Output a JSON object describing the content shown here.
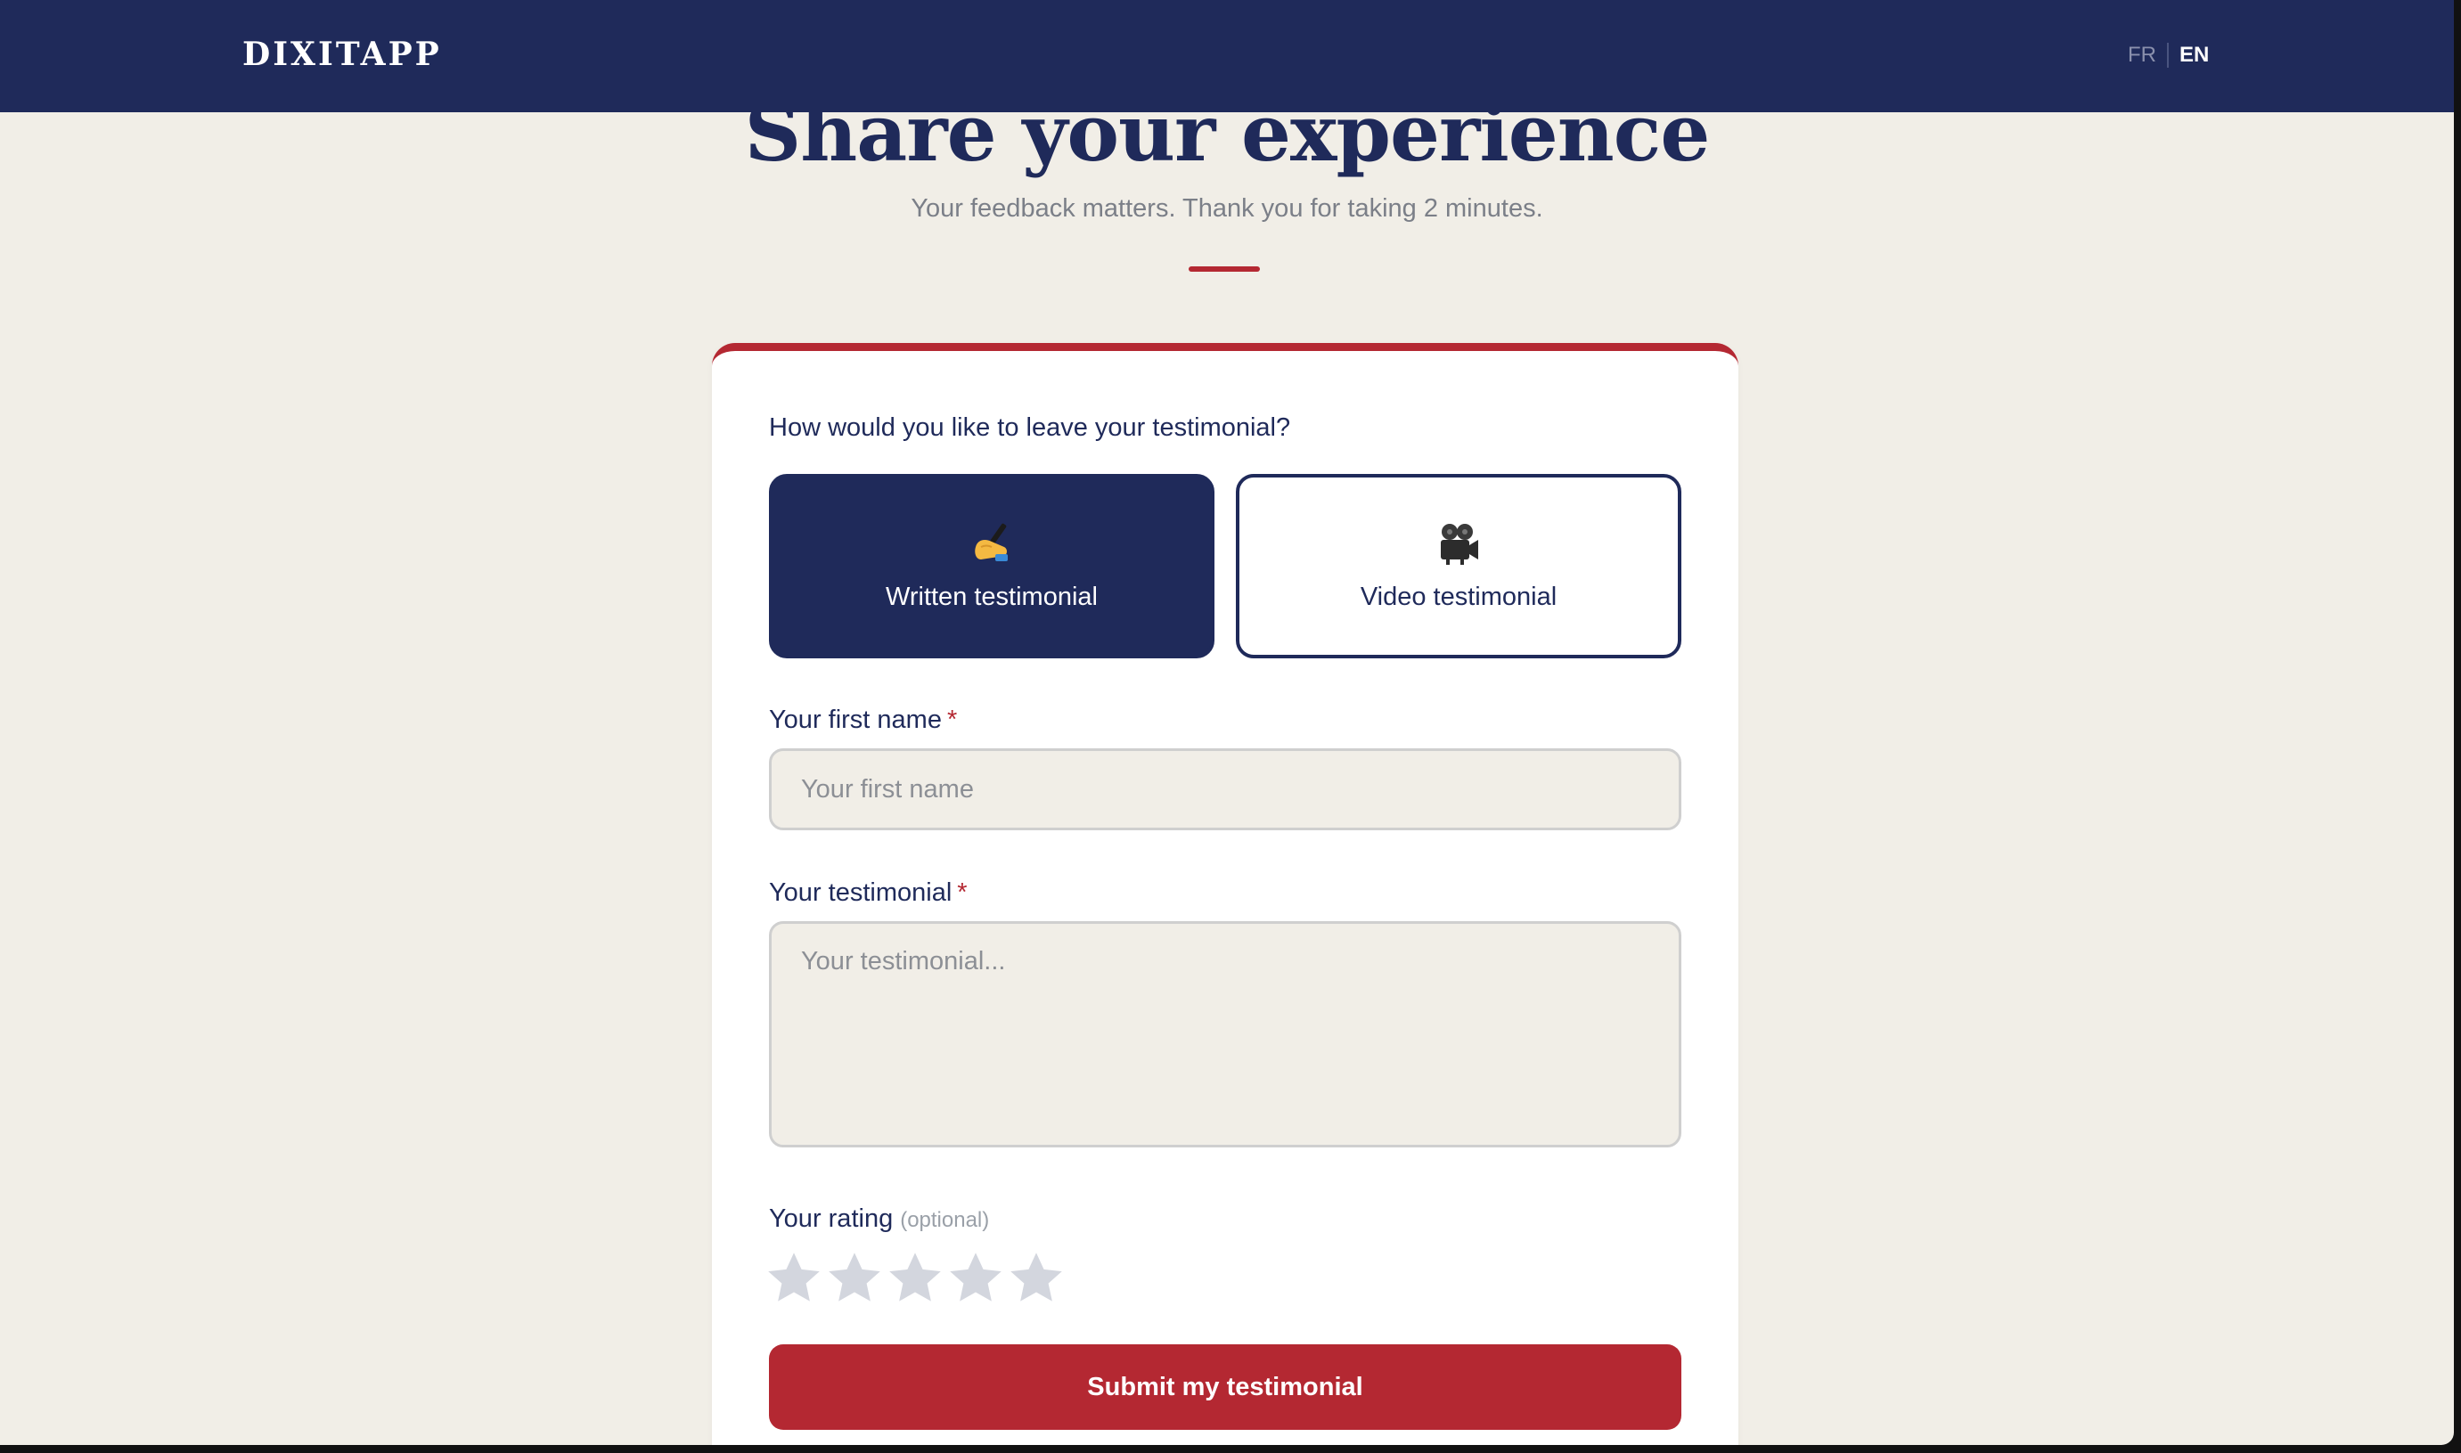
{
  "navbar": {
    "logo": "DIXITAPP",
    "lang_fr": "FR",
    "lang_en": "EN"
  },
  "hero": {
    "title": "Share your experience",
    "subtitle": "Your feedback matters. Thank you for taking 2 minutes."
  },
  "form": {
    "question": "How would you like to leave your testimonial?",
    "options": [
      {
        "label": "Written testimonial",
        "icon": "writing-hand-icon",
        "selected": true
      },
      {
        "label": "Video testimonial",
        "icon": "movie-camera-icon",
        "selected": false
      }
    ],
    "first_name": {
      "label": "Your first name",
      "required_mark": "*",
      "placeholder": "Your first name",
      "value": ""
    },
    "testimonial": {
      "label": "Your testimonial",
      "required_mark": "*",
      "placeholder": "Your testimonial...",
      "value": ""
    },
    "rating": {
      "label": "Your rating",
      "optional_note": "(optional)",
      "max": 5,
      "value": 0
    },
    "submit_label": "Submit my testimonial"
  },
  "colors": {
    "navy": "#1f2a5a",
    "accent_red": "#b42832",
    "page_bg": "#f1eee7",
    "star_empty": "#d3d6de"
  }
}
